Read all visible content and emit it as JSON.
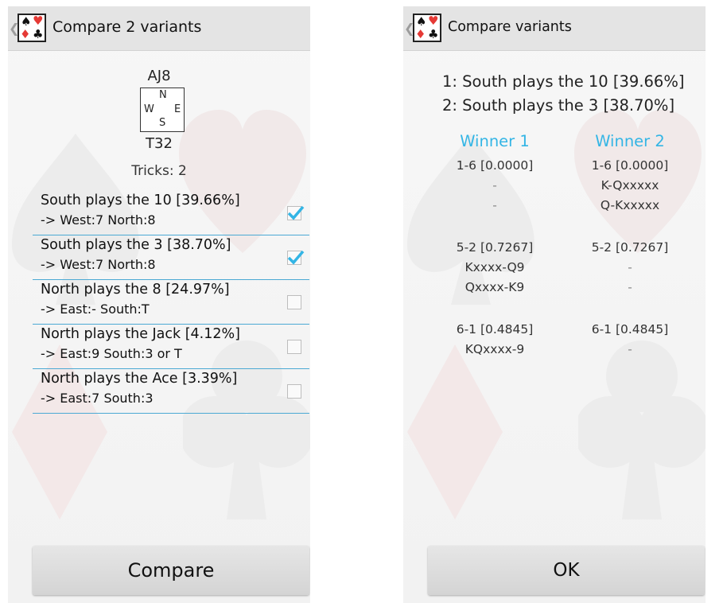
{
  "colors": {
    "accent": "#33b5e5",
    "divider": "#4ba9d4",
    "heart": "#e53935",
    "spade": "#111111"
  },
  "icons": {
    "app": "card-suits-icon",
    "up": "chevron-left-icon",
    "check": "checkmark-icon"
  },
  "left": {
    "title": "Compare 2 variants",
    "board": {
      "north_holding": "AJ8",
      "south_holding": "T32",
      "compass": {
        "n": "N",
        "w": "W",
        "e": "E",
        "s": "S"
      }
    },
    "tricks": "Tricks: 2",
    "variants": [
      {
        "line1": "South plays the 10 [39.66%]",
        "line2": "-> West:7  North:8",
        "checked": true
      },
      {
        "line1": "South plays the 3 [38.70%]",
        "line2": "-> West:7  North:8",
        "checked": true
      },
      {
        "line1": "North plays the 8 [24.97%]",
        "line2": "-> East:-  South:T",
        "checked": false
      },
      {
        "line1": "North plays the Jack [4.12%]",
        "line2": "-> East:9  South:3 or T",
        "checked": false
      },
      {
        "line1": "North plays the Ace [3.39%]",
        "line2": "-> East:7  South:3",
        "checked": false
      }
    ],
    "compare_button": "Compare"
  },
  "right": {
    "title": "Compare variants",
    "headings": [
      "1: South plays the 10 [39.66%]",
      "2: South plays the 3 [38.70%]"
    ],
    "winner1": {
      "label": "Winner 1",
      "groups": [
        [
          "1-6 [0.0000]",
          "-",
          "-"
        ],
        [
          "5-2 [0.7267]",
          "Kxxxx-Q9",
          "Qxxxx-K9"
        ],
        [
          "6-1 [0.4845]",
          "KQxxxx-9"
        ]
      ]
    },
    "winner2": {
      "label": "Winner 2",
      "groups": [
        [
          "1-6 [0.0000]",
          "K-Qxxxxx",
          "Q-Kxxxxx"
        ],
        [
          "5-2 [0.7267]",
          "-",
          "-"
        ],
        [
          "6-1 [0.4845]",
          "-"
        ]
      ]
    },
    "ok_button": "OK"
  }
}
